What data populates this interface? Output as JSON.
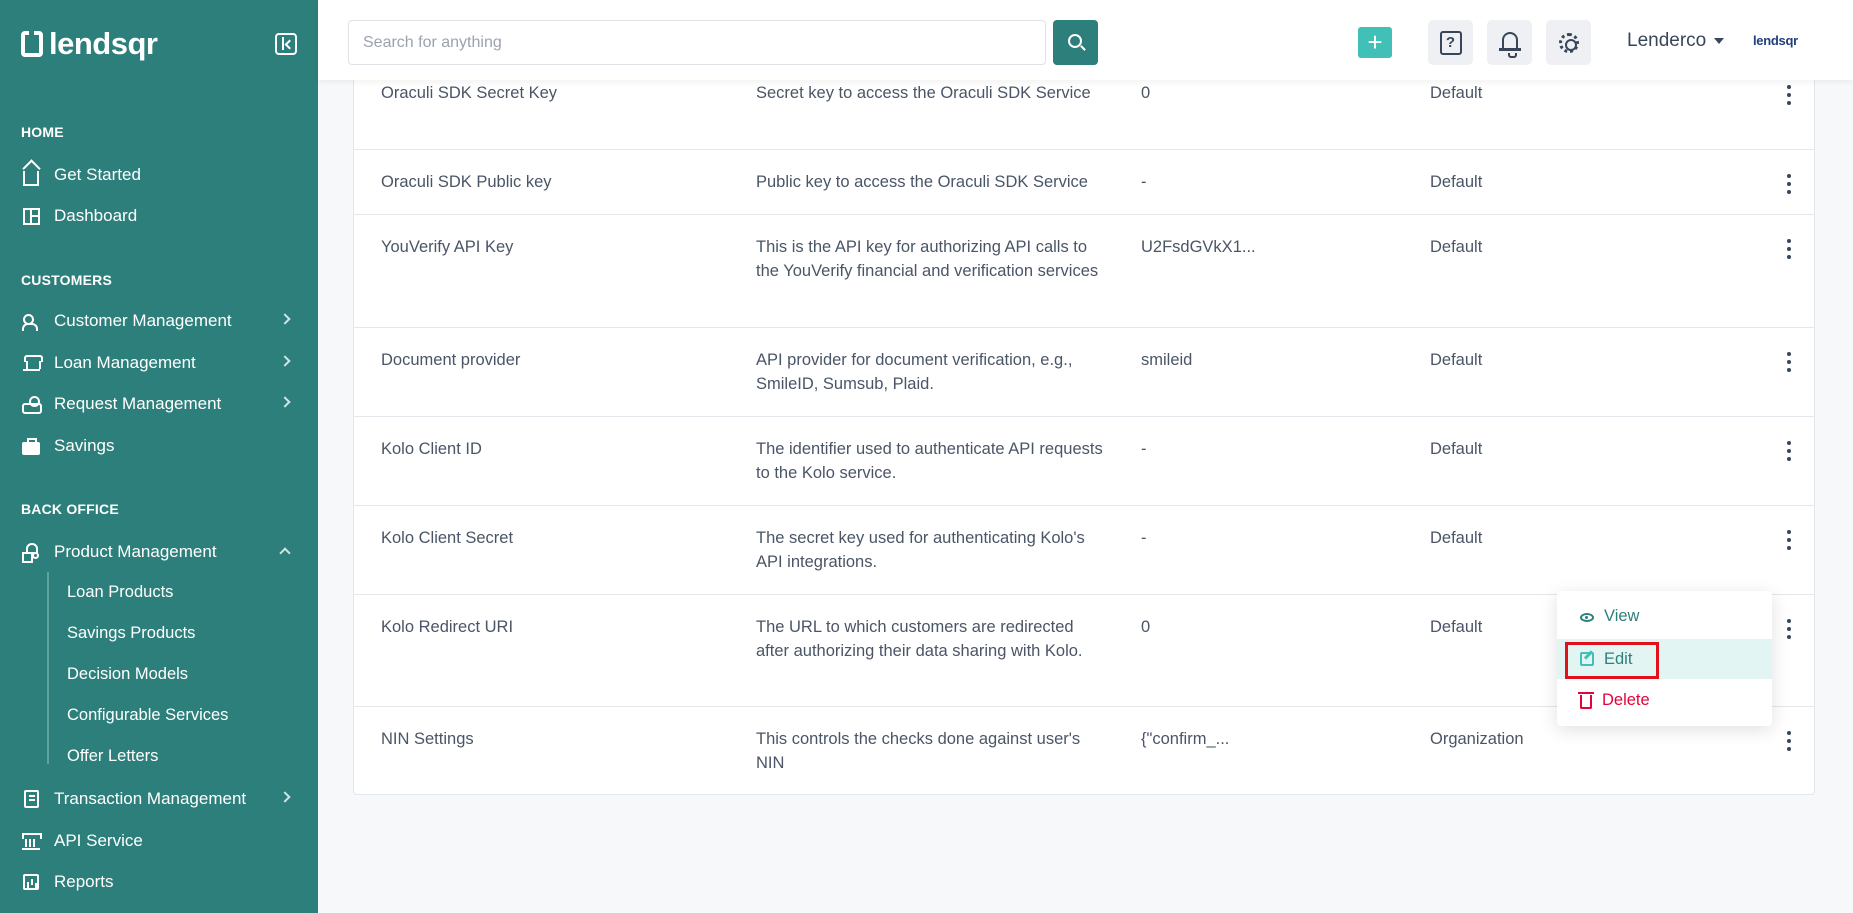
{
  "brand": {
    "name": "lendsqr",
    "small": "lendsqr"
  },
  "sidebar": {
    "sections": {
      "home": "HOME",
      "customers": "CUSTOMERS",
      "back_office": "BACK OFFICE"
    },
    "items": {
      "get_started": "Get Started",
      "dashboard": "Dashboard",
      "customer_management": "Customer Management",
      "loan_management": "Loan Management",
      "request_management": "Request Management",
      "savings": "Savings",
      "product_management": "Product Management",
      "transaction_management": "Transaction Management",
      "api_service": "API Service",
      "reports": "Reports"
    },
    "product_submenu": [
      "Loan Products",
      "Savings Products",
      "Decision Models",
      "Configurable Services",
      "Offer Letters"
    ]
  },
  "header": {
    "search_placeholder": "Search for anything",
    "plus_label": "+",
    "help_label": "?",
    "user_name": "Lenderco"
  },
  "table": {
    "rows": [
      {
        "name": "Oraculi SDK Secret Key",
        "description": "Secret key to access the Oraculi SDK Service",
        "value": "0",
        "scope": "Default"
      },
      {
        "name": "Oraculi SDK Public key",
        "description": "Public key to access the Oraculi SDK Service",
        "value": "-",
        "scope": "Default"
      },
      {
        "name": "YouVerify API Key",
        "description": "This is the API key for authorizing API calls to the YouVerify financial and verification services",
        "value": "U2FsdGVkX1...",
        "scope": "Default"
      },
      {
        "name": "Document provider",
        "description": "API provider for document verification, e.g., SmileID, Sumsub, Plaid.",
        "value": "smileid",
        "scope": "Default"
      },
      {
        "name": "Kolo Client ID",
        "description": "The identifier used to authenticate API requests to the Kolo service.",
        "value": "-",
        "scope": "Default"
      },
      {
        "name": "Kolo Client Secret",
        "description": "The secret key used for authenticating Kolo's API integrations.",
        "value": "-",
        "scope": "Default"
      },
      {
        "name": "Kolo Redirect URI",
        "description": "The URL to which customers are redirected after authorizing their data sharing with Kolo.",
        "value": "0",
        "scope": "Default"
      },
      {
        "name": "NIN Settings",
        "description": "This controls the checks done against user's NIN",
        "value": "{\"confirm_...",
        "scope": "Organization"
      }
    ]
  },
  "dropdown": {
    "view": "View",
    "edit": "Edit",
    "delete": "Delete"
  },
  "colors": {
    "sidebar": "#2d7f7b",
    "accent": "#40c0b6",
    "danger": "#e4033b",
    "highlight": "#e0101c"
  }
}
